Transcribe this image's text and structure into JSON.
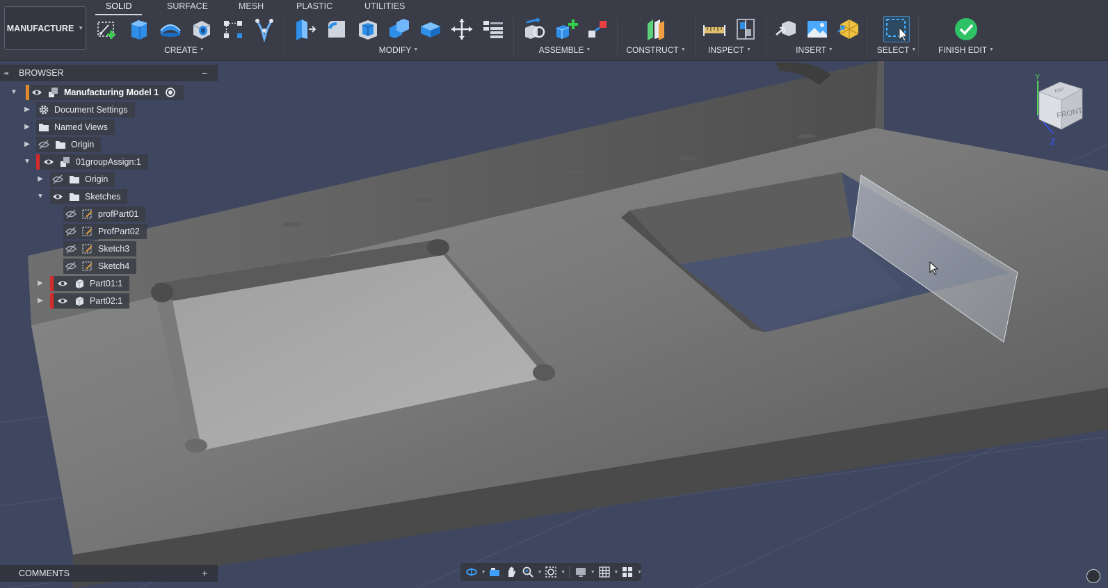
{
  "workspace": {
    "label": "MANUFACTURE"
  },
  "tabs": [
    {
      "label": "SOLID",
      "active": true
    },
    {
      "label": "SURFACE",
      "active": false
    },
    {
      "label": "MESH",
      "active": false
    },
    {
      "label": "PLASTIC",
      "active": false
    },
    {
      "label": "UTILITIES",
      "active": false
    }
  ],
  "groups": {
    "create": "CREATE",
    "modify": "MODIFY",
    "assemble": "ASSEMBLE",
    "construct": "CONSTRUCT",
    "inspect": "INSPECT",
    "insert": "INSERT",
    "select": "SELECT",
    "finish": "FINISH EDIT"
  },
  "icons": {
    "create": [
      "create-sketch-icon",
      "extrude-icon",
      "revolve-icon",
      "hole-icon",
      "pattern-icon",
      "create-form-icon"
    ],
    "modify": [
      "press-pull-icon",
      "fillet-icon",
      "shell-icon",
      "combine-icon",
      "replace-face-icon",
      "move-copy-icon",
      "change-parameters-icon"
    ],
    "assemble": [
      "joint-icon",
      "new-component-icon",
      "as-built-joint-icon"
    ],
    "construct": [
      "offset-plane-icon"
    ],
    "inspect": [
      "measure-icon",
      "section-analysis-icon"
    ],
    "insert": [
      "insert-derive-icon",
      "canvas-icon",
      "insert-mesh-icon"
    ],
    "select": [
      "select-window-icon"
    ],
    "finish": [
      "finish-edit-check-icon"
    ]
  },
  "browser": {
    "title": "BROWSER",
    "items": [
      {
        "label": "Manufacturing Model 1",
        "icon": "component-icon",
        "expanded": true,
        "visible": true,
        "root": true
      },
      {
        "label": "Document Settings",
        "icon": "gear-icon"
      },
      {
        "label": "Named Views",
        "icon": "folder-icon"
      },
      {
        "label": "Origin",
        "icon": "folder-icon",
        "visible": false
      },
      {
        "label": "01groupAssign:1",
        "icon": "component-icon",
        "expanded": true,
        "visible": true
      },
      {
        "label": "Origin",
        "icon": "folder-icon",
        "visible": false
      },
      {
        "label": "Sketches",
        "icon": "folder-icon",
        "expanded": true,
        "visible": true
      },
      {
        "label": "profPart01",
        "icon": "sketch-icon",
        "visible": false
      },
      {
        "label": "ProfPart02",
        "icon": "sketch-icon",
        "visible": false
      },
      {
        "label": "Sketch3",
        "icon": "sketch-icon",
        "visible": false
      },
      {
        "label": "Sketch4",
        "icon": "sketch-icon",
        "visible": false
      },
      {
        "label": "Part01:1",
        "icon": "body-icon",
        "visible": true
      },
      {
        "label": "Part02:1",
        "icon": "body-icon",
        "visible": true
      }
    ]
  },
  "comments": {
    "title": "COMMENTS"
  },
  "viewcube": {
    "top_label": "TOP",
    "front_label": "FRONT",
    "y_axis": "Y",
    "z_axis": "Z"
  },
  "colors": {
    "toolbar_bg": "#3a3d47",
    "viewport_bg": "#3d4459",
    "accent_blue": "#1e90ff",
    "finish_green": "#2fc265",
    "issue_red": "#d42b2b",
    "axis_y": "#5ad15a",
    "axis_z": "#3a4fe0"
  }
}
